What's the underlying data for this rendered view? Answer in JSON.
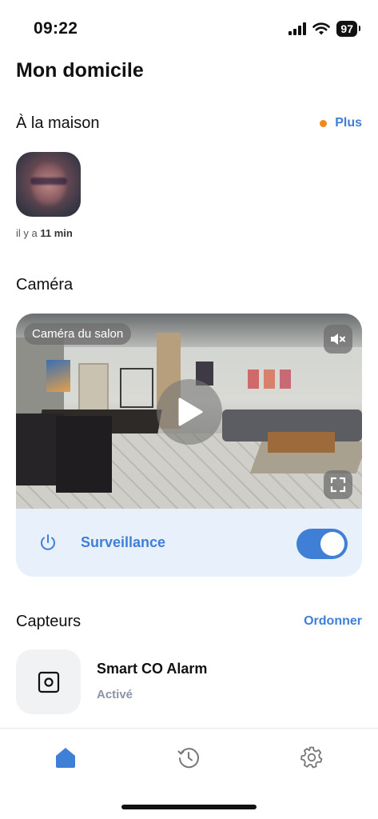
{
  "status_bar": {
    "time": "09:22",
    "battery": "97"
  },
  "page_title": "Mon domicile",
  "home_section": {
    "title": "À la maison",
    "more_label": "Plus",
    "time_ago_prefix": "il y a ",
    "time_ago_value": "11 min"
  },
  "camera_section": {
    "title": "Caméra",
    "camera_name": "Caméra du salon",
    "surveillance_label": "Surveillance",
    "surveillance_on": true
  },
  "sensors_section": {
    "title": "Capteurs",
    "order_label": "Ordonner",
    "items": [
      {
        "name": "Smart CO Alarm",
        "status": "Activé"
      }
    ]
  },
  "colors": {
    "accent": "#3f7fd6",
    "orange_dot": "#f08a1c",
    "card_bg": "#e8f0fb"
  },
  "tabs": [
    {
      "icon": "home-icon",
      "active": true
    },
    {
      "icon": "history-icon",
      "active": false
    },
    {
      "icon": "settings-icon",
      "active": false
    }
  ]
}
